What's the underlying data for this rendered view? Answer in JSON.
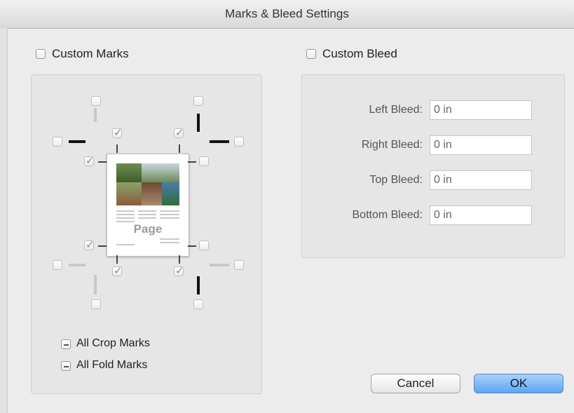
{
  "window": {
    "title": "Marks & Bleed Settings"
  },
  "marks": {
    "custom_label": "Custom Marks",
    "preview_page_label": "Page",
    "all_crop_label": "All Crop Marks",
    "all_fold_label": "All Fold Marks"
  },
  "bleed": {
    "custom_label": "Custom Bleed",
    "fields": [
      {
        "label": "Left Bleed:",
        "value": "0 in"
      },
      {
        "label": "Right Bleed:",
        "value": "0 in"
      },
      {
        "label": "Top Bleed:",
        "value": "0 in"
      },
      {
        "label": "Bottom Bleed:",
        "value": "0 in"
      }
    ]
  },
  "buttons": {
    "cancel": "Cancel",
    "ok": "OK"
  }
}
